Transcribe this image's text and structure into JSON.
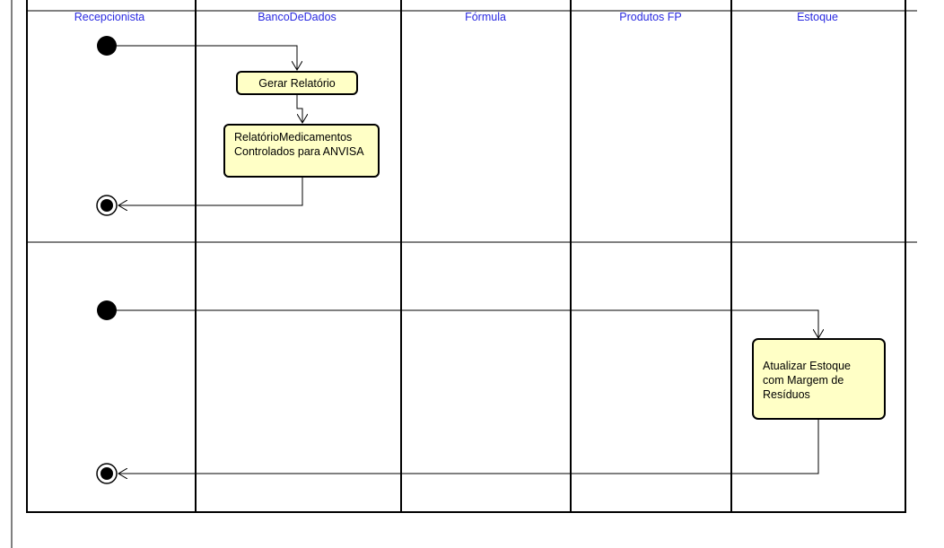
{
  "diagram": {
    "swimlanes": [
      "Recepcionista",
      "BancoDeDados",
      "Fórmula",
      "Produtos FP",
      "Estoque"
    ],
    "activities": [
      {
        "lines": [
          "Gerar Relatório"
        ]
      },
      {
        "lines": [
          "RelatórioMedicamentos",
          "Controlados para ANVISA"
        ]
      },
      {
        "lines": [
          "Atualizar Estoque",
          "com Margem de",
          "Resíduos"
        ]
      }
    ]
  },
  "colors": {
    "lane_title": "#2a2ae0",
    "activity_fill": "#ffffc6",
    "line": "#000000",
    "start_arrow": "#808080"
  }
}
